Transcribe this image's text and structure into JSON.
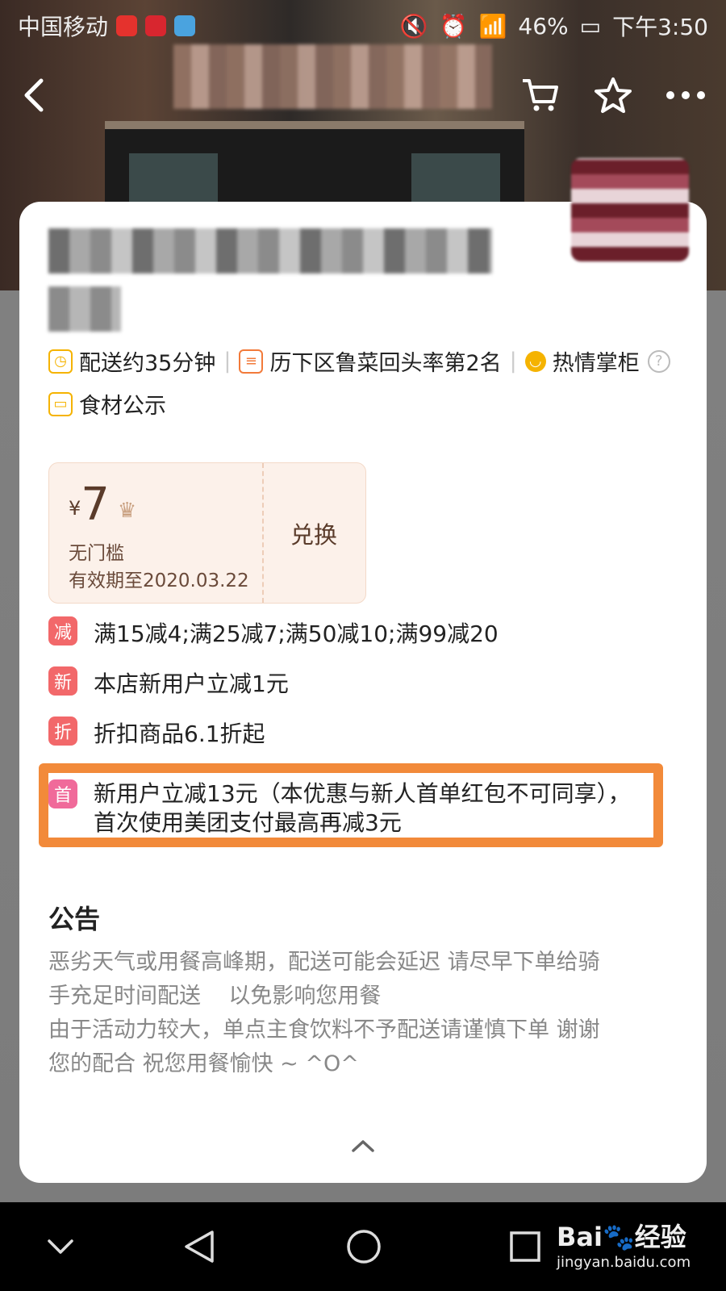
{
  "status_bar": {
    "carrier": "中国移动",
    "battery": "46%",
    "time": "下午3:50"
  },
  "store": {
    "tags": [
      {
        "icon": "clock-icon",
        "text": "配送约35分钟"
      },
      {
        "icon": "ranking-icon",
        "text": "历下区鲁菜回头率第2名"
      },
      {
        "icon": "smile-icon",
        "text": "热情掌柜"
      },
      {
        "icon": "ingredients-icon",
        "text": "食材公示"
      }
    ]
  },
  "coupon": {
    "currency": "¥",
    "amount": "7",
    "condition": "无门槛",
    "valid_until": "有效期至2020.03.22",
    "redeem_label": "兑换"
  },
  "promotions": [
    {
      "badge": "减",
      "color": "#f2686a",
      "text": "满15减4;满25减7;满50减10;满99减20"
    },
    {
      "badge": "新",
      "color": "#f2686a",
      "text": "本店新用户立减1元"
    },
    {
      "badge": "折",
      "color": "#f2686a",
      "text": "折扣商品6.1折起"
    },
    {
      "badge": "首",
      "color": "#f06a9a",
      "text": "新用户立减13元（本优惠与新人首单红包不可同享），",
      "text2": "首次使用美团支付最高再减3元"
    }
  ],
  "notice": {
    "title": "公告",
    "line1": "恶劣天气或用餐高峰期，配送可能会延迟 请尽早下单给骑",
    "line2": "手充足时间配送    以免影响您用餐",
    "line3": "由于活动力较大，单点主食饮料不予配送请谨慎下单 谢谢",
    "line4": "您的配合 祝您用餐愉快 ~ ^O^"
  },
  "watermark": {
    "brand": "Bai",
    "brand2": "经验",
    "url": "jingyan.baidu.com"
  }
}
